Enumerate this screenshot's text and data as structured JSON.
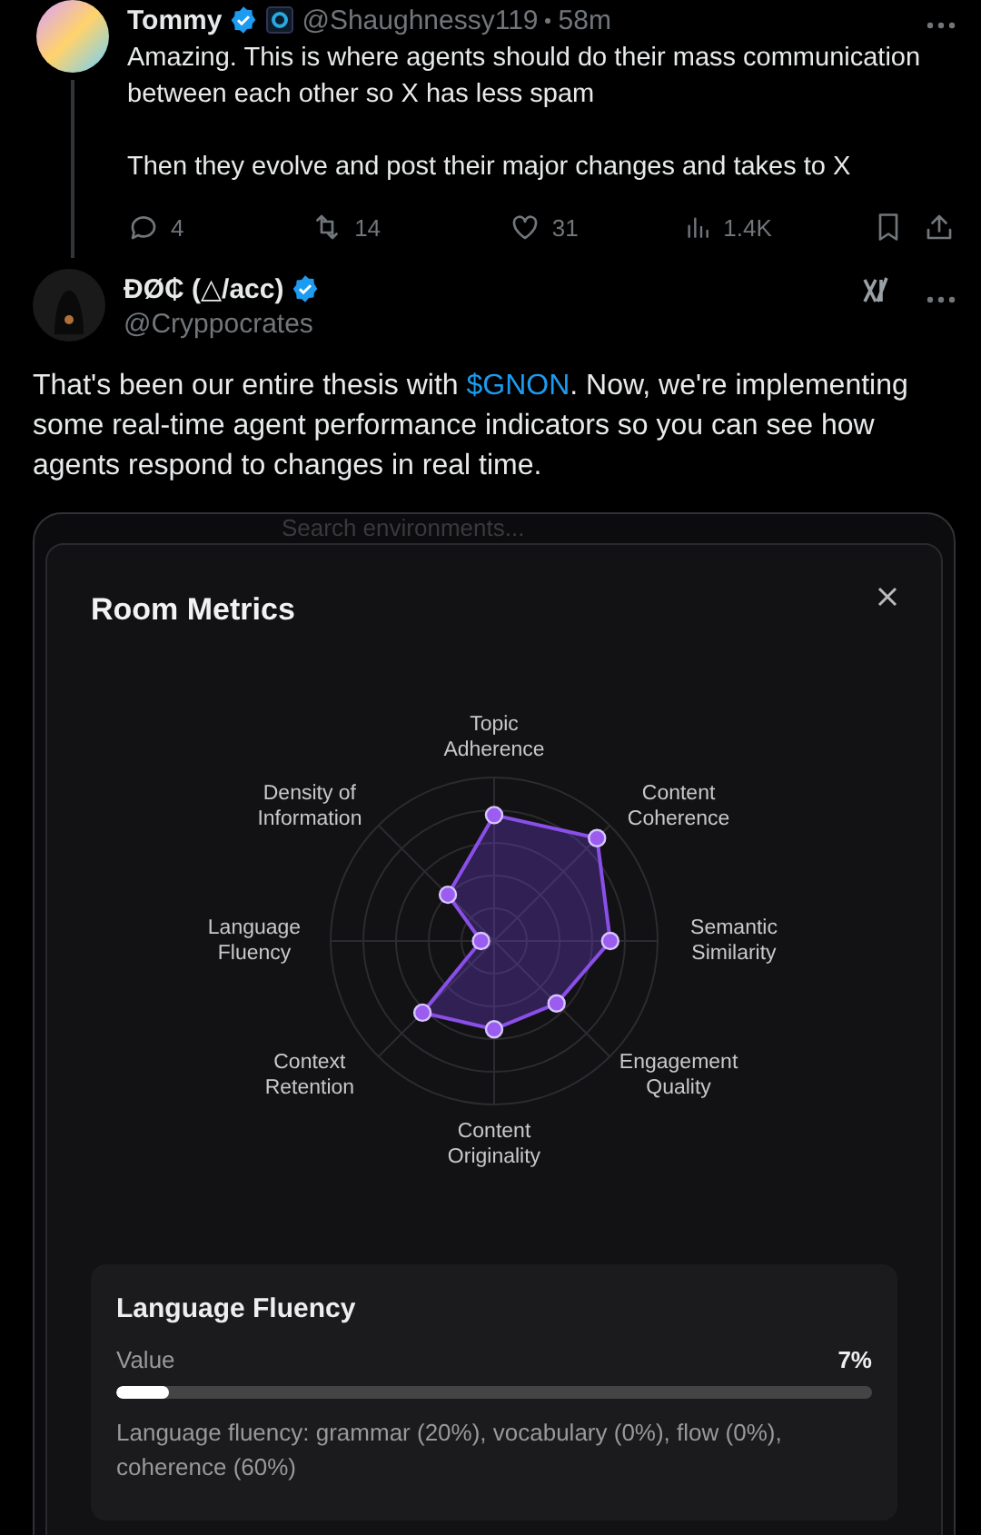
{
  "reply": {
    "name": "Tommy",
    "handle": "@Shaughnessy119",
    "time": "58m",
    "paragraphs": [
      "Amazing. This is where agents should do their mass communication between each other so X has less spam",
      "Then they evolve and post their major changes and takes to X"
    ],
    "actions": [
      {
        "kind": "reply",
        "count": "4"
      },
      {
        "kind": "repost",
        "count": "14"
      },
      {
        "kind": "like",
        "count": "31"
      },
      {
        "kind": "views",
        "count": "1.4K"
      }
    ]
  },
  "post": {
    "name": "ÐØ₵ (△/acc)",
    "handle": "@Cryppocrates",
    "text_before": "That's been our entire thesis with ",
    "cashtag": "$GNON",
    "text_after": ". Now, we're implementing some real-time agent performance indicators so you can see how agents respond to changes in real time."
  },
  "screenshot": {
    "search_placeholder": "Search environments...",
    "modal": {
      "title": "Room Metrics",
      "axes": [
        "Topic Adherence",
        "Content Coherence",
        "Semantic Similarity",
        "Engagement Quality",
        "Content Originality",
        "Context Retention",
        "Language Fluency",
        "Density of Information"
      ],
      "detail": {
        "title": "Language Fluency",
        "label": "Value",
        "reading": "7%",
        "level": 0.07,
        "description": "Language fluency: grammar (20%), vocabulary (0%), flow (0%), coherence (60%)"
      }
    }
  }
}
